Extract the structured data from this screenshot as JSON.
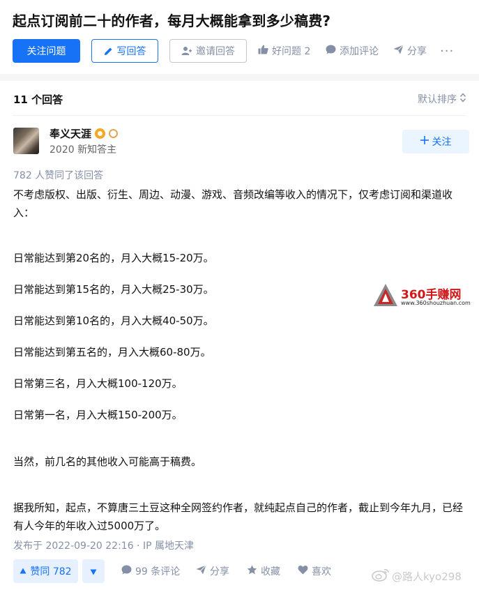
{
  "question": {
    "title": "起点订阅前二十的作者，每月大概能拿到多少稿费?",
    "buttons": {
      "follow": "关注问题",
      "write": "写回答",
      "invite": "邀请回答"
    },
    "actions": {
      "good": "好问题 2",
      "comment": "添加评论",
      "share": "分享",
      "more": "···"
    }
  },
  "answers_header": {
    "count": "11 个回答",
    "sort": "默认排序"
  },
  "answer": {
    "author_name": "奉义天涯",
    "author_tag": "2020 新知答主",
    "follow_label": "关注",
    "votes_line": "782 人赞同了该回答",
    "paragraphs": [
      "不考虑版权、出版、衍生、周边、动漫、游戏、音频改编等收入的情况下，仅考虑订阅和渠道收入：",
      "日常能达到第20名的，月入大概15-20万。",
      "日常能达到第15名的，月入大概25-30万。",
      "日常能达到第10名的，月入大概40-50万。",
      "日常能达到第五名的，月入大概60-80万。",
      "日常第三名，月入大概100-120万。",
      "日常第一名，月入大概150-200万。",
      "当然，前几名的其他收入可能高于稿费。",
      "据我所知，起点，不算唐三土豆这种全网签约作者，就纯起点自己的作者，截止到今年九月，已经有人今年的年收入过5000万了。"
    ],
    "published": "发布于 2022-09-20 22:16 · IP 属地天津",
    "bottom": {
      "vote_up": "赞同 782",
      "comments": "99 条评论",
      "share": "分享",
      "favorite": "收藏",
      "like": "喜欢"
    }
  },
  "watermark": {
    "title": "360手赚网",
    "url": "www.360shouzhuan.com"
  },
  "weibo_watermark": "@路人kyo298",
  "colors": {
    "primary": "#1772f6",
    "muted": "#8590a6",
    "text": "#121212",
    "watermark_red": "#d01818"
  },
  "icons": [
    "plus-icon",
    "pencil-icon",
    "invite-user-icon",
    "thumb-up-icon",
    "comment-bubble-icon",
    "share-arrow-icon",
    "sort-arrows-icon",
    "gold-badge-icon",
    "ring-badge-icon",
    "triangle-up-icon",
    "triangle-down-icon",
    "star-icon",
    "heart-icon",
    "weibo-icon"
  ]
}
